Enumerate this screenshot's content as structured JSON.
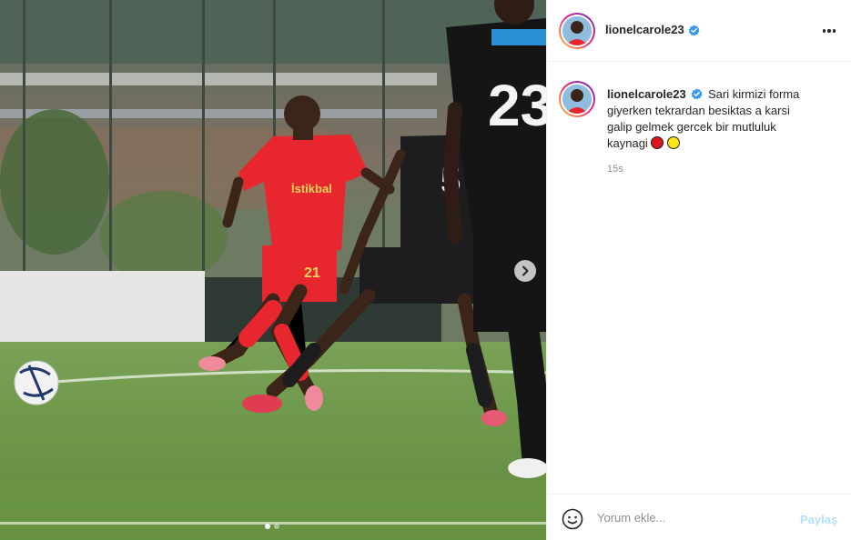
{
  "post": {
    "username": "lionelcarole23",
    "verified": true,
    "more_icon": "more-horizontal-icon",
    "caption": {
      "username": "lionelcarole23",
      "text": "Sari kirmizi forma giyerken tekrardan besiktas a karsi galip gelmek gercek bir mutluluk kaynagi",
      "emojis": [
        "red-circle",
        "yellow-circle"
      ]
    },
    "timestamp": "15s",
    "carousel": {
      "current": 1,
      "total": 2
    },
    "jersey_text": "İstikbal",
    "jersey_number": "21",
    "opponent_number": "23"
  },
  "comment": {
    "placeholder": "Yorum ekle...",
    "post_label": "Paylaş",
    "emoji_icon": "smiley-icon"
  },
  "colors": {
    "accent_disabled": "#b2dffc",
    "verified_blue": "#3897f0",
    "muted": "#8e8e8e"
  }
}
